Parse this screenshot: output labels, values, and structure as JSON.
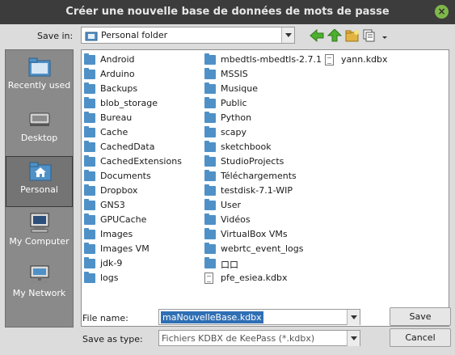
{
  "window": {
    "title": "Créer une nouvelle base de données de mots de passe"
  },
  "location": {
    "label": "Save in:",
    "value": "Personal folder"
  },
  "places": [
    {
      "label": "Recently used",
      "icon": "recent-folder-icon"
    },
    {
      "label": "Desktop",
      "icon": "desktop-icon"
    },
    {
      "label": "Personal",
      "icon": "home-folder-icon"
    },
    {
      "label": "My Computer",
      "icon": "computer-icon"
    },
    {
      "label": "My Network",
      "icon": "network-icon"
    }
  ],
  "files": {
    "col1": [
      "Android",
      "Arduino",
      "Backups",
      "blob_storage",
      "Bureau",
      "Cache",
      "CachedData",
      "CachedExtensions",
      "Documents",
      "Dropbox",
      "GNS3",
      "GPUCache",
      "Images",
      "Images VM",
      "jdk-9",
      "logs"
    ],
    "col2": [
      "mbedtls-mbedtls-2.7.1",
      "MSSIS",
      "Musique",
      "Public",
      "Python",
      "scapy",
      "sketchbook",
      "StudioProjects",
      "Téléchargements",
      "testdisk-7.1-WIP",
      "User",
      "Vidéos",
      "VirtualBox VMs",
      "webrtc_event_logs",
      "口口",
      "pfe_esiea.kdbx"
    ],
    "col3": [
      "yann.kdbx"
    ]
  },
  "form": {
    "filename_label": "File name:",
    "filename_value": "maNouvelleBase.kdbx",
    "type_label": "Save as type:",
    "type_value": "Fichiers KDBX de KeePass (*.kdbx)"
  },
  "buttons": {
    "save": "Save",
    "cancel": "Cancel"
  },
  "colors": {
    "titlebar": "#3c3c3c",
    "folder": "#4f91c7",
    "selection": "#2f6fb4",
    "close_button": "#7fb84a"
  }
}
